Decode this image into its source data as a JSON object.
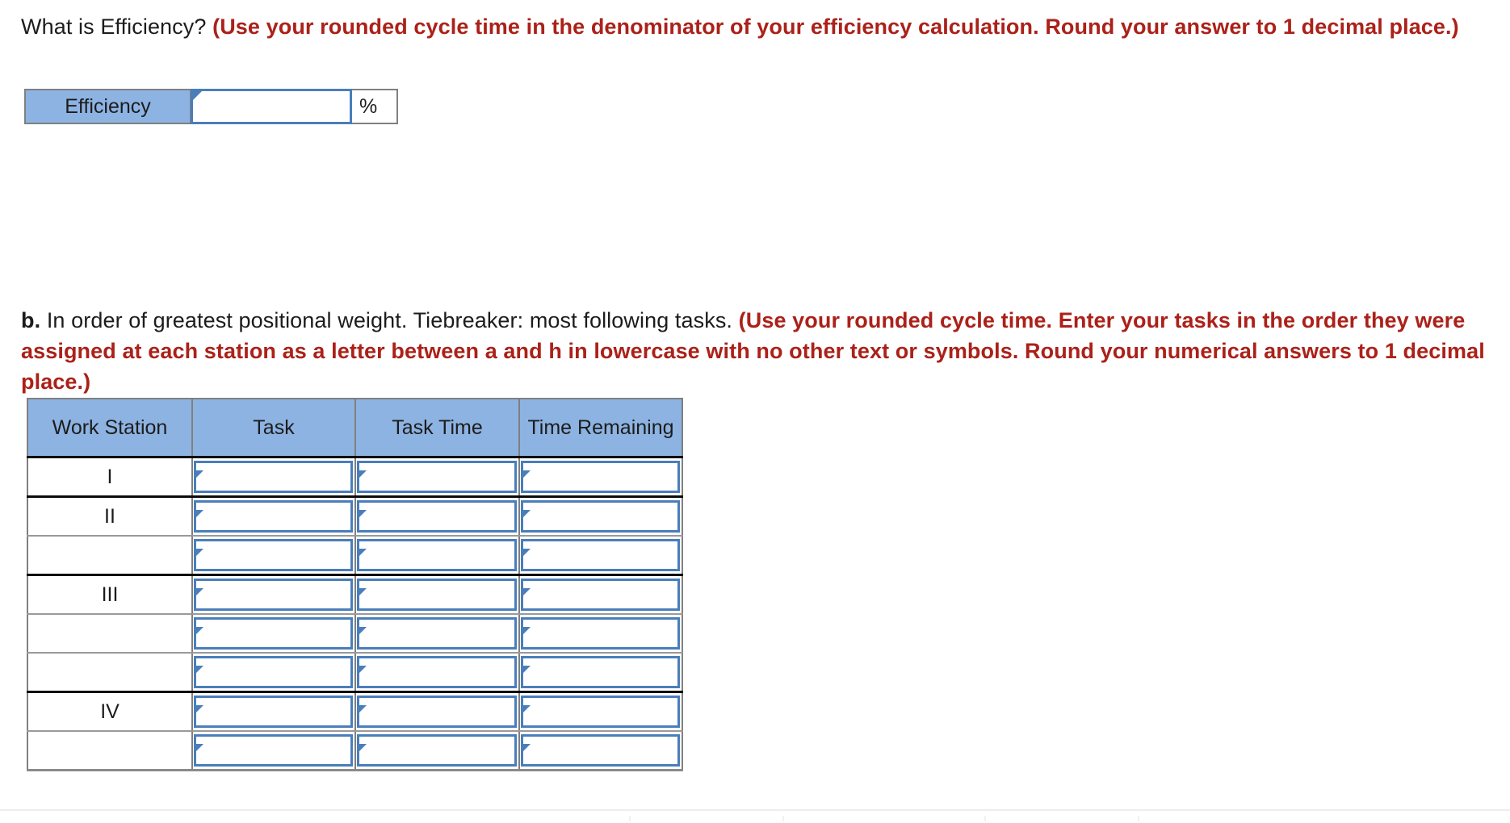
{
  "question_a": {
    "prompt": "What is Efficiency?",
    "note": "(Use your rounded cycle time in the denominator of your efficiency calculation. Round your answer to 1 decimal place.)",
    "label": "Efficiency",
    "value": "",
    "unit": "%"
  },
  "question_b": {
    "letter": "b.",
    "prompt": "In order of greatest positional weight. Tiebreaker: most following tasks.",
    "note": "(Use your rounded cycle time. Enter your tasks in the order they were assigned at each station as a letter between a and h in lowercase with no other text or symbols. Round your numerical answers to 1 decimal place.)"
  },
  "table": {
    "headers": [
      "Work Station",
      "Task",
      "Task Time",
      "Time Remaining"
    ],
    "rows": [
      {
        "station": "I",
        "task": "",
        "task_time": "",
        "time_remaining": "",
        "group_start": true,
        "last": false
      },
      {
        "station": "II",
        "task": "",
        "task_time": "",
        "time_remaining": "",
        "group_start": true,
        "last": false
      },
      {
        "station": "",
        "task": "",
        "task_time": "",
        "time_remaining": "",
        "group_start": false,
        "last": false
      },
      {
        "station": "III",
        "task": "",
        "task_time": "",
        "time_remaining": "",
        "group_start": true,
        "last": false
      },
      {
        "station": "",
        "task": "",
        "task_time": "",
        "time_remaining": "",
        "group_start": false,
        "last": false
      },
      {
        "station": "",
        "task": "",
        "task_time": "",
        "time_remaining": "",
        "group_start": false,
        "last": false
      },
      {
        "station": "IV",
        "task": "",
        "task_time": "",
        "time_remaining": "",
        "group_start": true,
        "last": false
      },
      {
        "station": "",
        "task": "",
        "task_time": "",
        "time_remaining": "",
        "group_start": false,
        "last": true
      }
    ]
  },
  "colors": {
    "header_blue": "#8db3e2",
    "input_border_blue": "#4a7ebb",
    "note_red": "#ab2119",
    "cell_border_gray": "#808080"
  }
}
